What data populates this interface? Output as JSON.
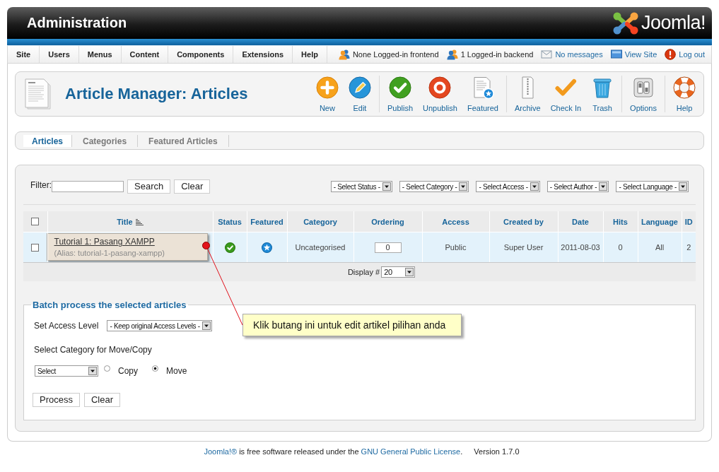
{
  "header": {
    "title": "Administration",
    "logo": "Joomla!"
  },
  "menu": [
    {
      "label": "Site"
    },
    {
      "label": "Users"
    },
    {
      "label": "Menus"
    },
    {
      "label": "Content"
    },
    {
      "label": "Components"
    },
    {
      "label": "Extensions"
    },
    {
      "label": "Help"
    }
  ],
  "status_items": [
    {
      "kind": "frontend",
      "label": "None Logged-in frontend"
    },
    {
      "kind": "backend",
      "label": "1 Logged-in backend"
    },
    {
      "kind": "messages",
      "label": "No messages"
    },
    {
      "kind": "site",
      "label": "View Site"
    },
    {
      "kind": "logout",
      "label": "Log out"
    }
  ],
  "toolbar": {
    "title": "Article Manager: Articles",
    "groups": [
      {
        "buttons": [
          {
            "kind": "new",
            "label": "New"
          },
          {
            "kind": "edit",
            "label": "Edit"
          }
        ]
      },
      {
        "buttons": [
          {
            "kind": "publish",
            "label": "Publish"
          },
          {
            "kind": "unpublish",
            "label": "Unpublish"
          },
          {
            "kind": "featured",
            "label": "Featured"
          }
        ]
      },
      {
        "buttons": [
          {
            "kind": "archive",
            "label": "Archive"
          },
          {
            "kind": "checkin",
            "label": "Check In"
          },
          {
            "kind": "trash",
            "label": "Trash"
          }
        ]
      },
      {
        "buttons": [
          {
            "kind": "options",
            "label": "Options"
          }
        ]
      },
      {
        "buttons": [
          {
            "kind": "help",
            "label": "Help"
          }
        ]
      }
    ]
  },
  "tabs": [
    {
      "label": "Articles",
      "selected": true
    },
    {
      "label": "Categories",
      "selected": false
    },
    {
      "label": "Featured Articles",
      "selected": false
    }
  ],
  "filter": {
    "label": "Filter:",
    "buttons": [
      "Search",
      "Clear"
    ],
    "selects": [
      {
        "value": "- Select Status -"
      },
      {
        "value": "- Select Category -"
      },
      {
        "value": "- Select Access -"
      },
      {
        "value": "- Select Author -"
      },
      {
        "value": "- Select Language -"
      }
    ]
  },
  "table": {
    "select_all": {
      "checked": false
    },
    "columns": [
      {
        "label": "Title",
        "sorted": true
      },
      {
        "label": "Status",
        "sorted": false
      },
      {
        "label": "Featured",
        "sorted": false
      },
      {
        "label": "Category",
        "sorted": false
      },
      {
        "label": "Ordering",
        "sorted": false
      },
      {
        "label": "Access",
        "sorted": false
      },
      {
        "label": "Created by",
        "sorted": false
      },
      {
        "label": "Date",
        "sorted": false
      },
      {
        "label": "Hits",
        "sorted": false
      },
      {
        "label": "Language",
        "sorted": false
      },
      {
        "label": "ID",
        "sorted": false
      }
    ],
    "rows": [
      {
        "checked": false,
        "highlighted": true,
        "annotated": true,
        "title": "Tutorial 1: Pasang XAMPP",
        "alias": "(Alias: tutorial-1-pasang-xampp)",
        "published": true,
        "featured": true,
        "category": "Uncategorised",
        "ordering": "0",
        "access": "Public",
        "created_by": "Super User",
        "date": "2011-08-03",
        "hits": "0",
        "language": "All",
        "id": "2"
      }
    ],
    "pagination": {
      "label": "Display #",
      "value": "20"
    }
  },
  "batch": {
    "legend": "Batch process the selected articles",
    "access_label": "Set Access Level",
    "access_value": "- Keep original Access Levels -",
    "category_label": "Select Category for Move/Copy",
    "category_value": "Select",
    "options": [
      {
        "label": "Copy",
        "selected": false
      },
      {
        "label": "Move",
        "selected": true
      }
    ],
    "buttons": [
      "Process",
      "Clear"
    ]
  },
  "annotation": {
    "text": "Klik butang ini untuk edit artikel pilihan anda"
  },
  "footer": {
    "sentence": [
      {
        "kind": "link",
        "text": "Joomla!®"
      },
      {
        "kind": "text",
        "text": " is free software released under the "
      },
      {
        "kind": "link",
        "text": "GNU General Public License"
      },
      {
        "kind": "text",
        "text": "."
      }
    ],
    "version": "Version 1.7.0"
  }
}
